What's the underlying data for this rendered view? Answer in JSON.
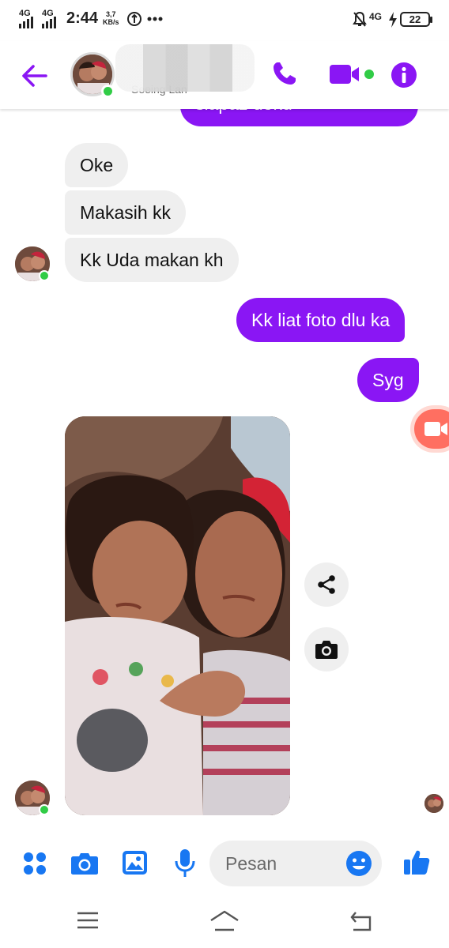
{
  "status_bar": {
    "network_1": "4G",
    "network_2": "4G",
    "time": "2:44",
    "speed_value": "3,7",
    "speed_unit": "KB/s",
    "right_network": "4G",
    "battery": "22",
    "icons": [
      "signal-icon",
      "signal-icon",
      "data-saver-icon",
      "more-dots-icon",
      "mute-bell-icon",
      "charging-bolt-icon",
      "battery-icon"
    ]
  },
  "header": {
    "status_text": "Seeing Lan",
    "icons": [
      "back-arrow-icon",
      "phone-icon",
      "video-camera-icon",
      "info-icon"
    ],
    "accent_color": "#8a16f4",
    "online_color": "#31cc46"
  },
  "messages": [
    {
      "direction": "outgoing",
      "text": "siapaz doku"
    },
    {
      "direction": "incoming",
      "text": "Oke"
    },
    {
      "direction": "incoming",
      "text": "Makasih kk"
    },
    {
      "direction": "incoming",
      "text": "Kk Uda makan kh"
    },
    {
      "direction": "outgoing",
      "text": "Kk liat foto dlu ka"
    },
    {
      "direction": "outgoing",
      "text": "Syg"
    },
    {
      "direction": "incoming",
      "type": "photo"
    }
  ],
  "photo_actions": [
    "share-icon",
    "camera-icon"
  ],
  "composer": {
    "placeholder": "Pesan",
    "icons": [
      "menu-dots-icon",
      "camera-icon",
      "gallery-icon",
      "microphone-icon",
      "emoji-icon",
      "like-icon"
    ],
    "icon_color": "#1877f2"
  },
  "nav_bar": {
    "icons": [
      "menu-lines-icon",
      "home-icon",
      "back-icon"
    ]
  }
}
